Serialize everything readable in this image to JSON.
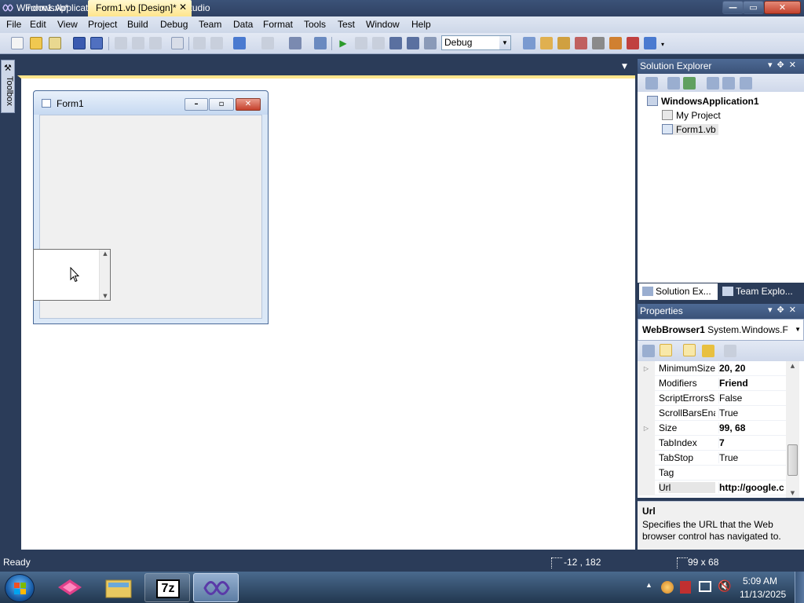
{
  "window": {
    "title": "WindowsApplication1 - Microsoft Visual Studio",
    "min_glyph": "—",
    "max_glyph": "▭",
    "close_glyph": "✕"
  },
  "menu": {
    "items": [
      "File",
      "Edit",
      "View",
      "Project",
      "Build",
      "Debug",
      "Team",
      "Data",
      "Format",
      "Tools",
      "Test",
      "Window",
      "Help"
    ]
  },
  "toolbar": {
    "configuration": "Debug"
  },
  "toolbox": {
    "label": "Toolbox"
  },
  "tabs": {
    "inactive": "Form1.vb*",
    "active": "Form1.vb [Design]*",
    "close_glyph": "✕",
    "dropdown_glyph": "▼"
  },
  "designer": {
    "form_title": "Form1"
  },
  "solution_explorer": {
    "title": "Solution Explorer",
    "solution": "WindowsApplication1",
    "items": [
      "My Project",
      "Form1.vb"
    ],
    "tab_active": "Solution Ex...",
    "tab_inactive": "Team Explo..."
  },
  "properties": {
    "title": "Properties",
    "object_name": "WebBrowser1",
    "object_type": "System.Windows.F",
    "rows": [
      {
        "name": "MinimumSize",
        "value": "20, 20",
        "bold": true,
        "expand": true
      },
      {
        "name": "Modifiers",
        "value": "Friend",
        "bold": true,
        "expand": false
      },
      {
        "name": "ScriptErrorsSu",
        "value": "False",
        "bold": false,
        "expand": false
      },
      {
        "name": "ScrollBarsEna",
        "value": "True",
        "bold": false,
        "expand": false
      },
      {
        "name": "Size",
        "value": "99, 68",
        "bold": true,
        "expand": true
      },
      {
        "name": "TabIndex",
        "value": "7",
        "bold": true,
        "expand": false
      },
      {
        "name": "TabStop",
        "value": "True",
        "bold": false,
        "expand": false
      },
      {
        "name": "Tag",
        "value": "",
        "bold": false,
        "expand": false
      },
      {
        "name": "Url",
        "value": "http://google.c",
        "bold": true,
        "expand": false
      }
    ],
    "desc_title": "Url",
    "desc_text": "Specifies the URL that the Web browser control has navigated to."
  },
  "status": {
    "text": "Ready",
    "position": "-12 , 182",
    "size": "99 x 68"
  },
  "taskbar": {
    "time": "5:09 AM",
    "date": "11/13/2025",
    "sevenzip_label": "7z"
  },
  "colors": {
    "accent": "#2b3c59",
    "active_tab": "#ffe58d",
    "close_red": "#c5402c"
  }
}
